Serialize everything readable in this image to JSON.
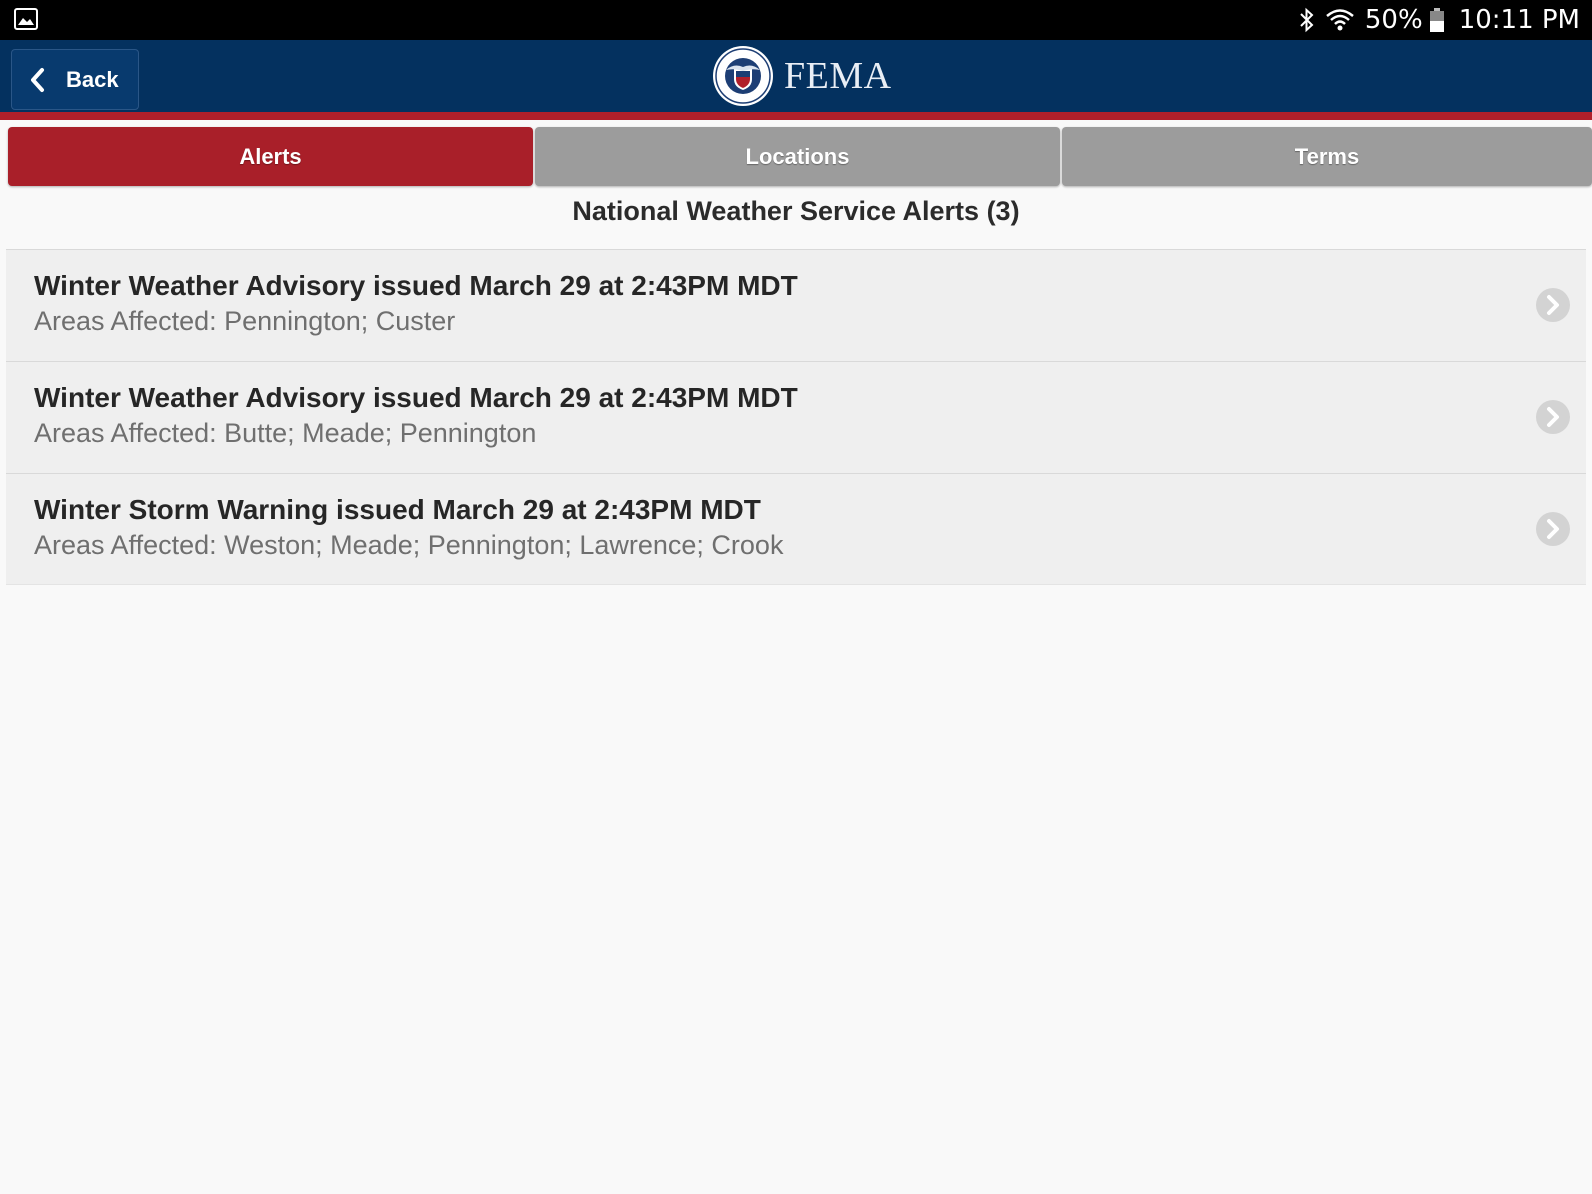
{
  "status_bar": {
    "left_icon": "gallery-icon",
    "battery_percent": "50%",
    "time": "10:11 PM",
    "icons": [
      "bluetooth-icon",
      "wifi-icon",
      "battery-icon"
    ]
  },
  "header": {
    "back_label": "Back",
    "brand_name": "FEMA",
    "colors": {
      "header_bg": "#04315f",
      "stripe": "#b11f2a"
    }
  },
  "tabs": [
    {
      "label": "Alerts",
      "active": true
    },
    {
      "label": "Locations",
      "active": false
    },
    {
      "label": "Terms",
      "active": false
    }
  ],
  "main": {
    "section_title": "National Weather Service Alerts (3)",
    "alerts": [
      {
        "title": "Winter Weather Advisory issued March 29 at 2:43PM MDT",
        "areas": "Areas Affected: Pennington; Custer"
      },
      {
        "title": "Winter Weather Advisory issued March 29 at 2:43PM MDT",
        "areas": "Areas Affected: Butte; Meade; Pennington"
      },
      {
        "title": "Winter Storm Warning issued March 29 at 2:43PM MDT",
        "areas": "Areas Affected: Weston; Meade; Pennington; Lawrence; Crook"
      }
    ]
  }
}
